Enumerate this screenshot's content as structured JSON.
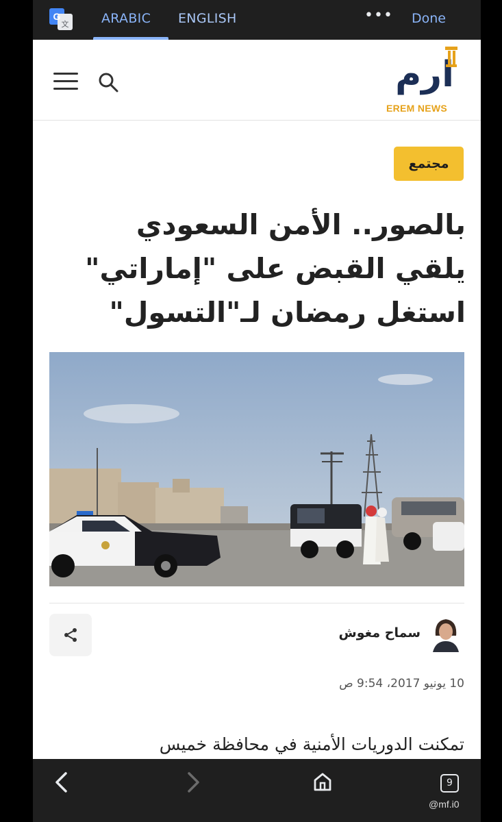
{
  "translate_bar": {
    "tab_arabic": "ARABIC",
    "tab_english": "ENGLISH",
    "done_label": "Done",
    "menu_label": "•••",
    "icon": "google-translate-icon"
  },
  "site": {
    "logo_text": "إرم",
    "logo_sub": "EREM NEWS",
    "brand_color": "#1c2f56",
    "accent_color": "#e6a21b"
  },
  "article": {
    "category": "مجتمع",
    "headline_line1": "بالصور.. الأمن السعودي",
    "headline_line2": "يلقي القبض على \"إماراتي\"",
    "headline_line3": "استغل رمضان لـ\"التسول\"",
    "author": "سماح مغوش",
    "date": "10 يونيو 2017، 9:54 ص",
    "body_start": "تمكنت الدوريات الأمنية في محافظة خميس"
  },
  "bottom_nav": {
    "tab_count": "9",
    "back_icon": "back-chevron-icon",
    "forward_icon": "forward-chevron-icon",
    "home_icon": "home-icon"
  },
  "watermark": "@mf.i0"
}
